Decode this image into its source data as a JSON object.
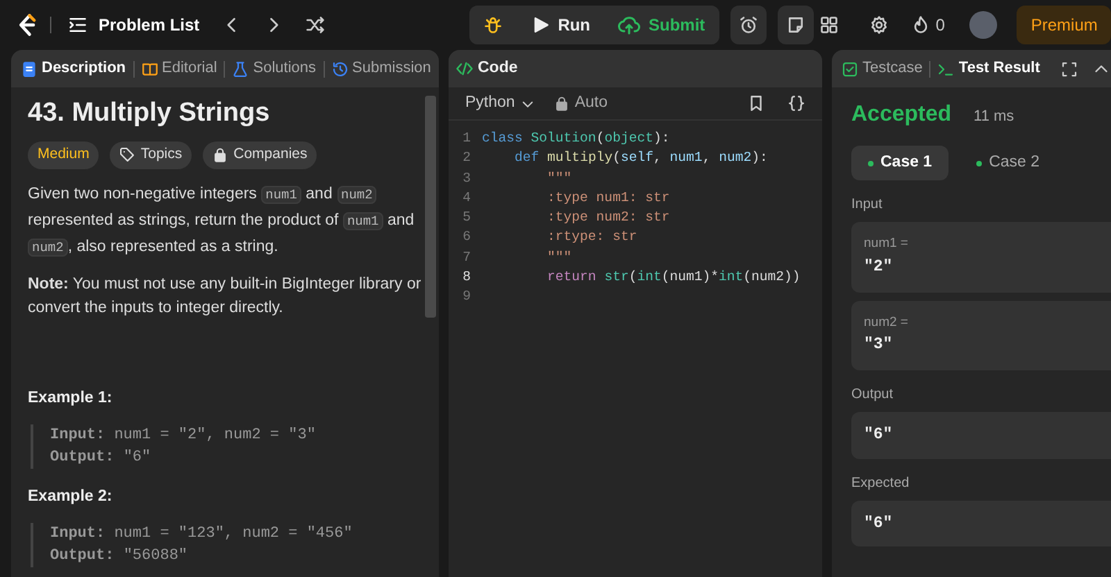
{
  "topbar": {
    "problem_list": "Problem List",
    "run": "Run",
    "submit": "Submit",
    "streak": "0",
    "premium": "Premium"
  },
  "description_panel": {
    "tabs": [
      {
        "label": "Description",
        "selected": true
      },
      {
        "label": "Editorial",
        "selected": false
      },
      {
        "label": "Solutions",
        "selected": false
      },
      {
        "label": "Submission",
        "selected": false
      }
    ],
    "title": "43. Multiply Strings",
    "difficulty": "Medium",
    "tags": [
      {
        "label": "Topics"
      },
      {
        "label": "Companies"
      }
    ],
    "statement": [
      {
        "text": "Given two non-negative integers ",
        "kind": "text"
      },
      {
        "text": "num1",
        "kind": "code"
      },
      {
        "text": " and ",
        "kind": "text"
      },
      {
        "text": "num2",
        "kind": "code"
      },
      {
        "text": " represented as strings, return the product of ",
        "kind": "text"
      },
      {
        "text": "num1",
        "kind": "code"
      },
      {
        "text": " and ",
        "kind": "text"
      },
      {
        "text": "num2",
        "kind": "code"
      },
      {
        "text": ", also represented as a string.",
        "kind": "text"
      }
    ],
    "note": "**Note:** You must not use any built-in BigInteger library or convert the inputs to integer directly.",
    "examples": [
      {
        "title": "Example 1:",
        "lines": [
          "**Input:** num1 = \"2\", num2 = \"3\"",
          "**Output:** \"6\""
        ]
      },
      {
        "title": "Example 2:",
        "lines": [
          "**Input:** num1 = \"123\", num2 = \"456\"",
          "**Output:** \"56088\""
        ]
      }
    ]
  },
  "code_panel": {
    "title": "Code",
    "language": "Python",
    "mode": "Auto",
    "lines": [
      {
        "number": "1",
        "active": false,
        "tokens": [
          {
            "t": "class ",
            "kind": "keyword"
          },
          {
            "t": "Solution",
            "kind": "type"
          },
          {
            "t": "(",
            "kind": "punct"
          },
          {
            "t": "object",
            "kind": "type"
          },
          {
            "t": "):",
            "kind": "punct"
          }
        ]
      },
      {
        "number": "2",
        "active": false,
        "tokens": [
          {
            "t": "    def ",
            "kind": "keyword"
          },
          {
            "t": "multiply",
            "kind": "function"
          },
          {
            "t": "(",
            "kind": "punct"
          },
          {
            "t": "self",
            "kind": "variable"
          },
          {
            "t": ", ",
            "kind": "punct"
          },
          {
            "t": "num1",
            "kind": "variable"
          },
          {
            "t": ", ",
            "kind": "punct"
          },
          {
            "t": "num2",
            "kind": "variable"
          },
          {
            "t": "):",
            "kind": "punct"
          }
        ]
      },
      {
        "number": "3",
        "active": false,
        "tokens": [
          {
            "t": "        \"\"\"",
            "kind": "string"
          }
        ]
      },
      {
        "number": "4",
        "active": false,
        "tokens": [
          {
            "t": "        :type num1: str",
            "kind": "string"
          }
        ]
      },
      {
        "number": "5",
        "active": false,
        "tokens": [
          {
            "t": "        :type num2: str",
            "kind": "string"
          }
        ]
      },
      {
        "number": "6",
        "active": false,
        "tokens": [
          {
            "t": "        :rtype: str",
            "kind": "string"
          }
        ]
      },
      {
        "number": "7",
        "active": false,
        "tokens": [
          {
            "t": "        \"\"\"",
            "kind": "string"
          }
        ]
      },
      {
        "number": "8",
        "active": true,
        "tokens": [
          {
            "t": "        return ",
            "kind": "control"
          },
          {
            "t": "str",
            "kind": "type"
          },
          {
            "t": "(",
            "kind": "punct"
          },
          {
            "t": "int",
            "kind": "type"
          },
          {
            "t": "(num1)*",
            "kind": "punct"
          },
          {
            "t": "int",
            "kind": "type"
          },
          {
            "t": "(num2))",
            "kind": "punct"
          }
        ]
      },
      {
        "number": "9",
        "active": false
      }
    ]
  },
  "result_panel": {
    "tabs": [
      {
        "label": "Testcase",
        "selected": false
      },
      {
        "label": "Test Result",
        "selected": true
      }
    ],
    "verdict": "Accepted",
    "runtime": "11 ms",
    "cases": [
      {
        "label": "Case 1",
        "selected": true
      },
      {
        "label": "Case 2",
        "selected": false
      }
    ],
    "input_label": "Input",
    "inputs": [
      {
        "name": "num1 =",
        "value": "\"2\""
      },
      {
        "name": "num2 =",
        "value": "\"3\""
      }
    ],
    "output_label": "Output",
    "output": "\"6\"",
    "expected_label": "Expected",
    "expected": "\"6\""
  }
}
